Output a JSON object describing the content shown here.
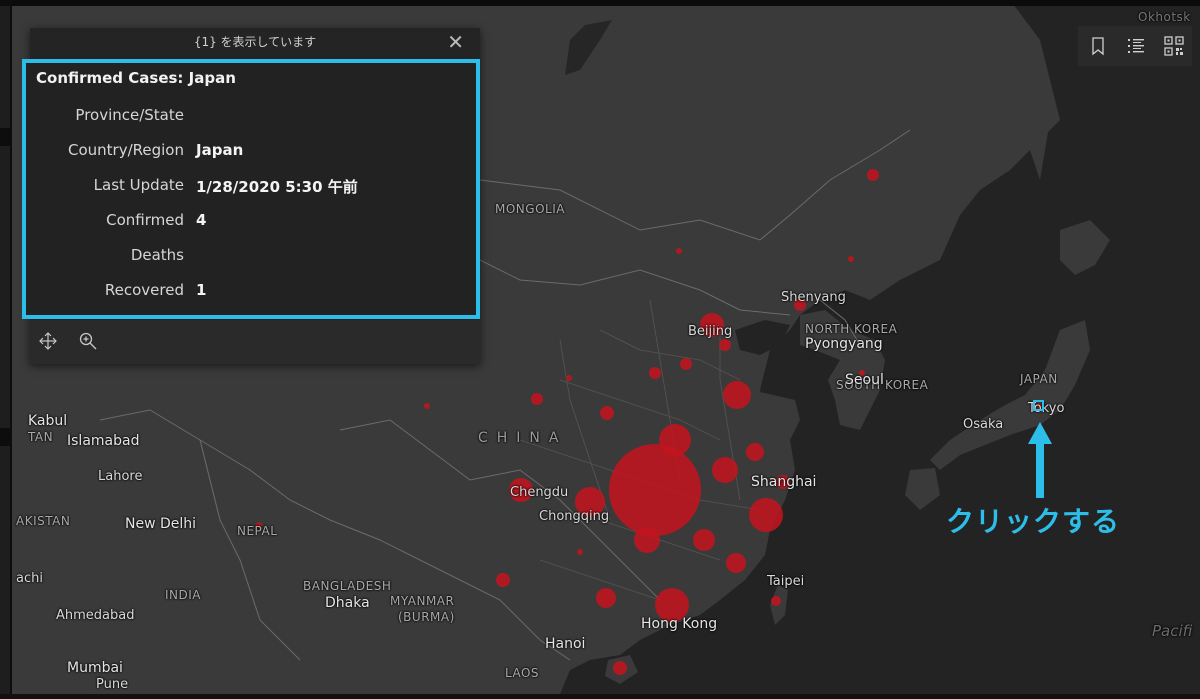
{
  "popup": {
    "header": "{1} を表示しています",
    "close_glyph": "✕",
    "title": "Confirmed Cases: Japan",
    "attributes": [
      {
        "key": "Province/State",
        "value": ""
      },
      {
        "key": "Country/Region",
        "value": "Japan"
      },
      {
        "key": "Last Update",
        "value": "1/28/2020 5:30 午前"
      },
      {
        "key": "Confirmed",
        "value": "4"
      },
      {
        "key": "Deaths",
        "value": ""
      },
      {
        "key": "Recovered",
        "value": "1"
      }
    ],
    "footer_icons": [
      "move-icon",
      "zoom-to-icon"
    ]
  },
  "toolbar": {
    "icons": [
      "bookmark-icon",
      "legend-list-icon",
      "qr-code-icon"
    ]
  },
  "annotation": {
    "text": "クリックする",
    "color": "#2cbde9"
  },
  "map_labels": {
    "mongolia": "MONGOLIA",
    "china": "CHINA",
    "north_korea": "NORTH KOREA",
    "south_korea": "SOUTH KOREA",
    "japan": "JAPAN",
    "india": "INDIA",
    "nepal": "NEPAL",
    "bangladesh": "BANGLADESH",
    "myanmar": "MYANMAR",
    "burma": "(BURMA)",
    "laos": "LAOS",
    "pakistan": "AKISTAN",
    "afghanistan": "TAN",
    "okhotsk": "Okhotsk",
    "pacific": "Pacifi",
    "cities": {
      "beijing": "Beijing",
      "shenyang": "Shenyang",
      "pyongyang": "Pyongyang",
      "seoul": "Seoul",
      "tokyo": "Tokyo",
      "osaka": "Osaka",
      "shanghai": "Shanghai",
      "chengdu": "Chengdu",
      "chongqing": "Chongqing",
      "taipei": "Taipei",
      "hong_kong": "Hong Kong",
      "hanoi": "Hanoi",
      "dhaka": "Dhaka",
      "kabul": "Kabul",
      "islamabad": "Islamabad",
      "lahore": "Lahore",
      "new_delhi": "New Delhi",
      "karachi": "achi",
      "ahmedabad": "Ahmedabad",
      "mumbai": "Mumbai",
      "pune": "Pune"
    }
  },
  "colors": {
    "land": "#3a3a3a",
    "water": "#232323",
    "case_marker": "#c1151f",
    "highlight": "#2cbde9"
  }
}
